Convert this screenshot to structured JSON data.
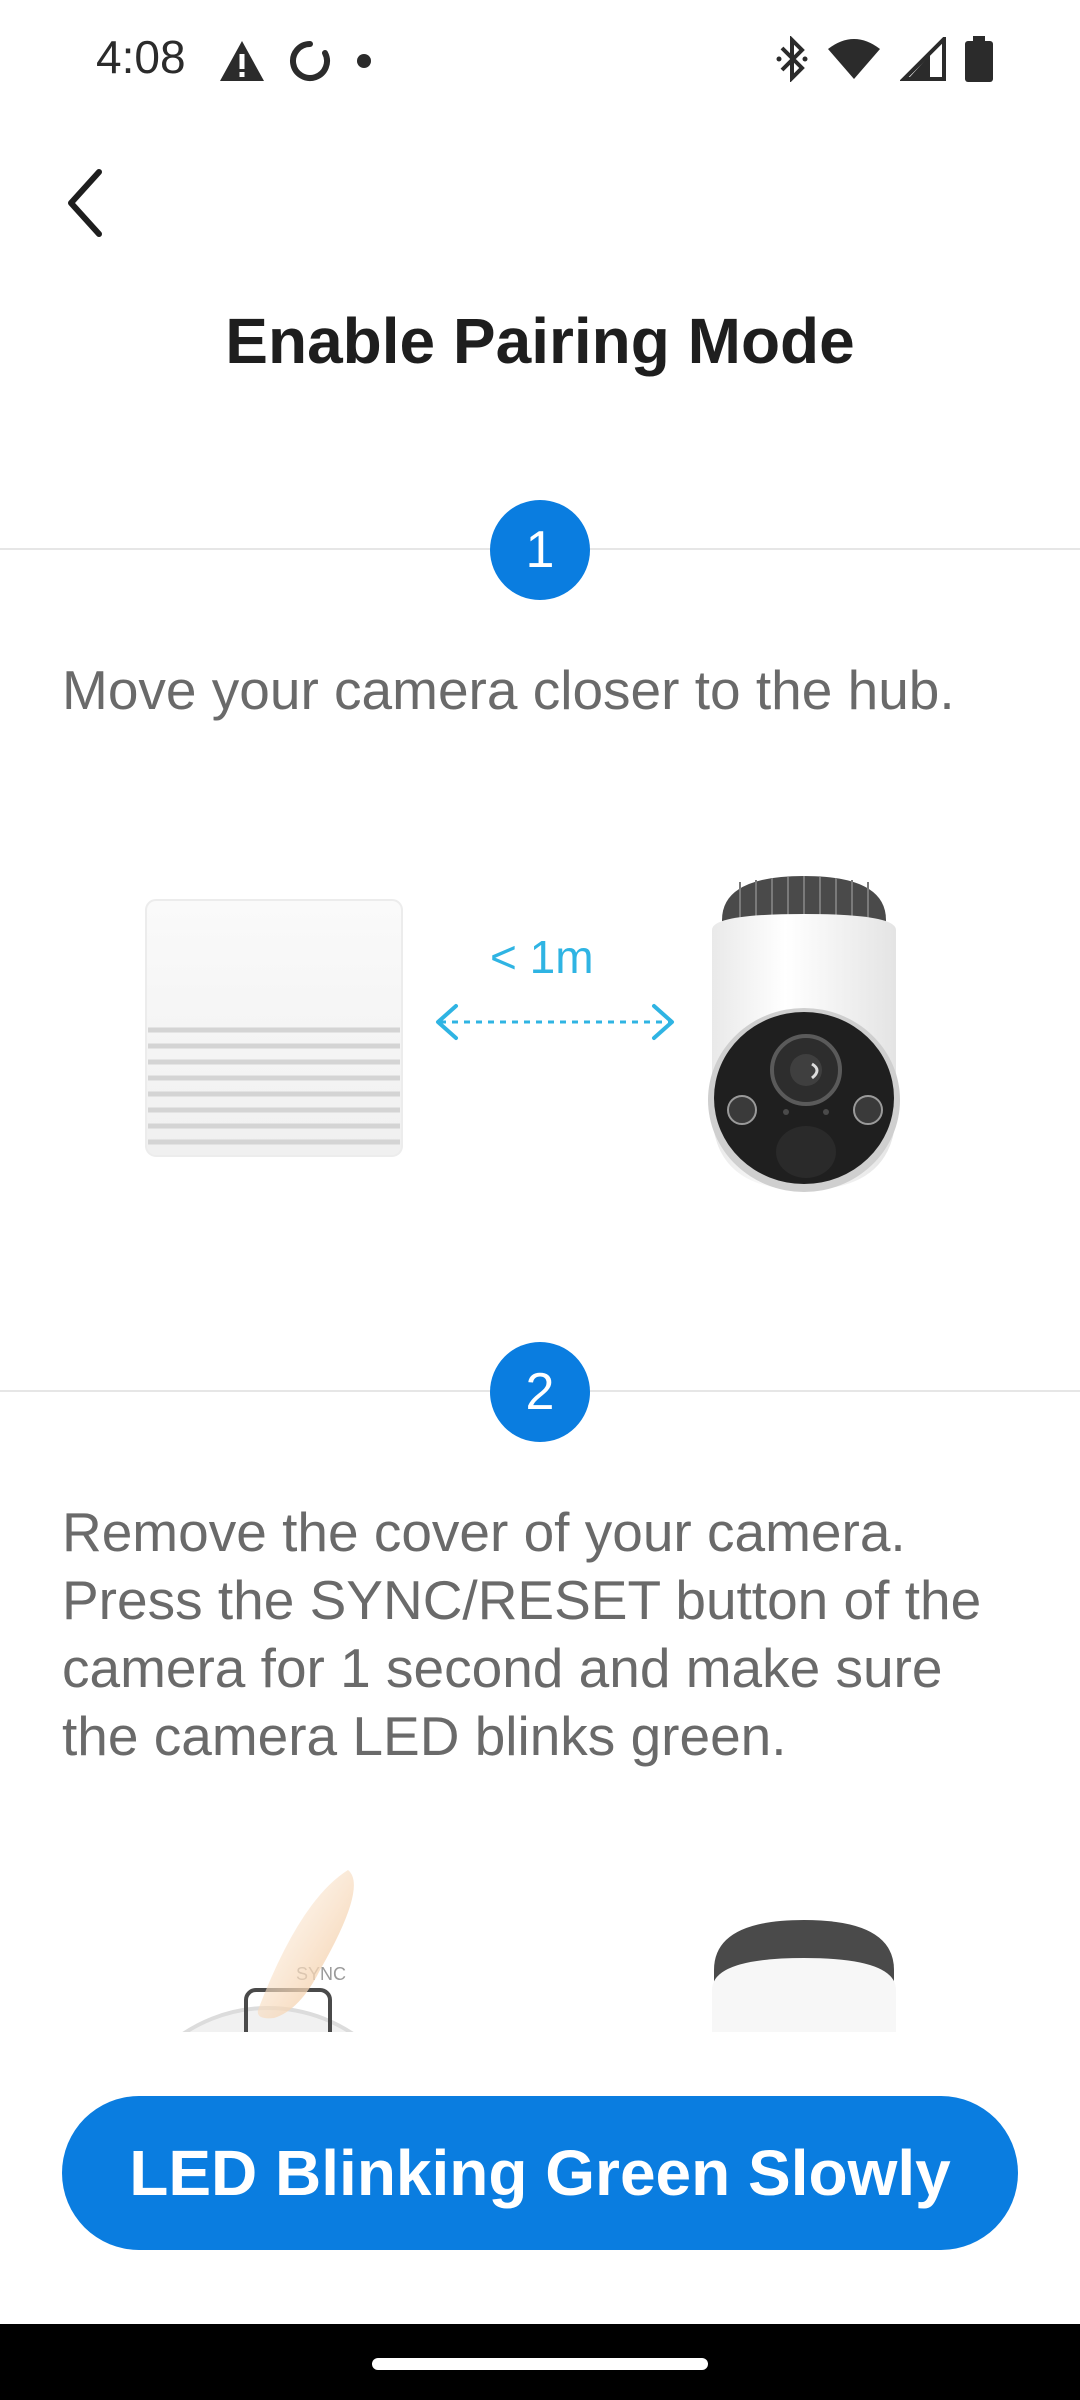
{
  "status_bar": {
    "time": "4:08",
    "left_icons": [
      "warning-icon",
      "circle-notification-icon",
      "dot-icon"
    ],
    "right_icons": [
      "bluetooth-icon",
      "wifi-icon",
      "cell-signal-icon",
      "battery-icon"
    ]
  },
  "header": {
    "back_icon": "chevron-left-icon",
    "title": "Enable Pairing Mode"
  },
  "steps": [
    {
      "number": "1",
      "text": "Move your camera closer to the hub.",
      "distance_label": "< 1m"
    },
    {
      "number": "2",
      "text": "Remove the cover of your camera. Press the SYNC/RESET button of the camera for 1 second and make sure the camera LED blinks green."
    }
  ],
  "primary_button": {
    "label": "LED Blinking Green Slowly"
  },
  "colors": {
    "accent": "#0a7de0",
    "distance_cyan": "#2fb4e3",
    "body_text": "#6a6a6a",
    "title_text": "#1e1e1e",
    "divider": "#e6e6e6"
  }
}
